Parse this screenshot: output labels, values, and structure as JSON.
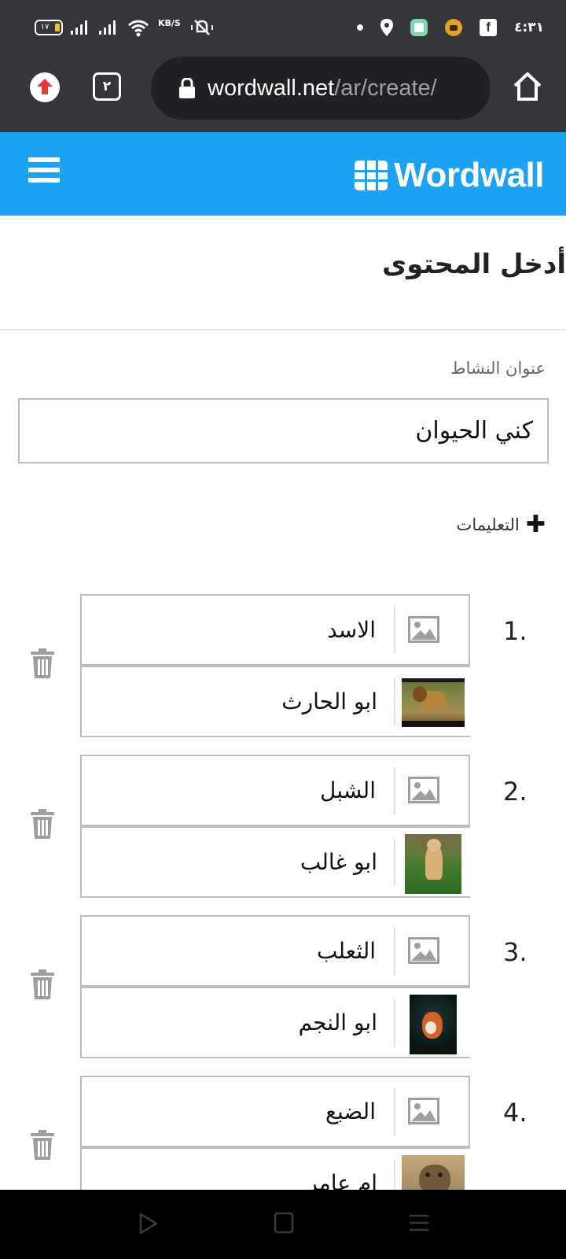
{
  "status_bar": {
    "battery_level": "١٧",
    "network_speed_value": "",
    "network_speed_unit": "KB/S",
    "time": "٤:٣١",
    "icons": [
      "battery-icon",
      "signal-icon",
      "signal-icon",
      "wifi-icon",
      "mute-icon",
      "dot-icon",
      "location-icon",
      "app-icon",
      "app-icon",
      "facebook-icon"
    ]
  },
  "browser": {
    "tab_count": "٢",
    "url_domain": "wordwall.net",
    "url_path": "/ar/create/",
    "icons": [
      "upload-icon",
      "tabs-icon",
      "lock-icon",
      "home-icon"
    ]
  },
  "header": {
    "brand": "Wordwall",
    "brand_color": "#1da1f2",
    "icons": [
      "menu-icon",
      "wordwall-logo-icon"
    ]
  },
  "page": {
    "title": "أدخل المحتوى",
    "activity_label": "عنوان النشاط",
    "activity_title": "كني الحيوان",
    "instructions_label": "التعليمات"
  },
  "items": [
    {
      "number": "1.",
      "word": "الاسد",
      "nickname": "ابو الحارث",
      "image": "lion"
    },
    {
      "number": "2.",
      "word": "الشبل",
      "nickname": "ابو غالب",
      "image": "cub"
    },
    {
      "number": "3.",
      "word": "الثعلب",
      "nickname": "ابو النجم",
      "image": "fox"
    },
    {
      "number": "4.",
      "word": "الضبع",
      "nickname": "ام عامر",
      "image": "hyena"
    }
  ]
}
